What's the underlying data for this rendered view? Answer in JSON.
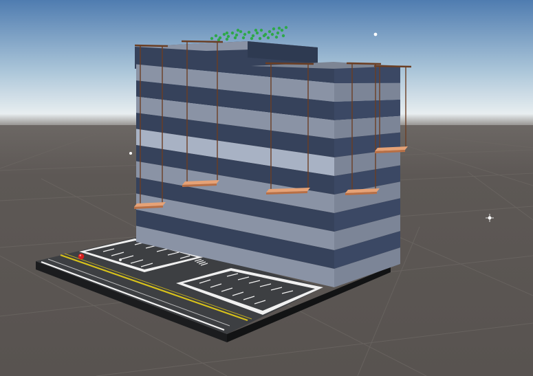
{
  "scene": {
    "type": "3d-editor-viewport",
    "environment": "default-skybox",
    "subject": "striped-office-building-with-hanging-window-washer-platforms",
    "palette": {
      "sky_top": "#4f7cb0",
      "sky_mid": "#a9c4d8",
      "horizon": "#e8eef0",
      "ground": "#5d5855",
      "grid_line": "#6a6561",
      "stripe_dark": "#36425b",
      "stripe_light_front": "#8a93a5",
      "stripe_light_side": "#7c8597",
      "stripe_light_bright": "#a8b2c4",
      "roof": "#7d8594",
      "rope": "#6b3e23",
      "platform_top": "#e6a276",
      "platform_side": "#b86f45",
      "road": "#3d3f42",
      "road_line_yellow": "#d8c21a",
      "road_line_white": "#f2f2f2",
      "tree_green": "#2ea84a",
      "marker_red": "#d41e1e"
    }
  }
}
